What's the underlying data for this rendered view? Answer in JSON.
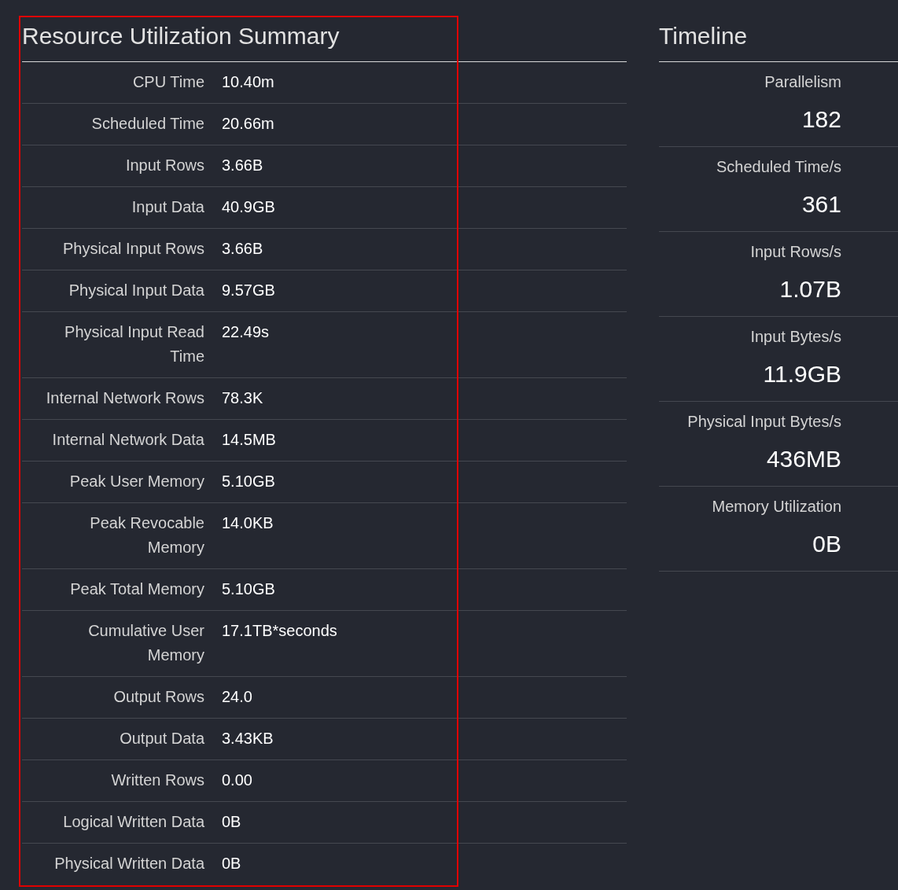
{
  "summary": {
    "title": "Resource Utilization Summary",
    "rows": [
      {
        "label": "CPU Time",
        "value": "10.40m"
      },
      {
        "label": "Scheduled Time",
        "value": "20.66m"
      },
      {
        "label": "Input Rows",
        "value": "3.66B"
      },
      {
        "label": "Input Data",
        "value": "40.9GB"
      },
      {
        "label": "Physical Input Rows",
        "value": "3.66B"
      },
      {
        "label": "Physical Input Data",
        "value": "9.57GB"
      },
      {
        "label": "Physical Input Read Time",
        "value": "22.49s"
      },
      {
        "label": "Internal Network Rows",
        "value": "78.3K"
      },
      {
        "label": "Internal Network Data",
        "value": "14.5MB"
      },
      {
        "label": "Peak User Memory",
        "value": "5.10GB"
      },
      {
        "label": "Peak Revocable Memory",
        "value": "14.0KB"
      },
      {
        "label": "Peak Total Memory",
        "value": "5.10GB"
      },
      {
        "label": "Cumulative User Memory",
        "value": "17.1TB*seconds"
      },
      {
        "label": "Output Rows",
        "value": "24.0"
      },
      {
        "label": "Output Data",
        "value": "3.43KB"
      },
      {
        "label": "Written Rows",
        "value": "0.00"
      },
      {
        "label": "Logical Written Data",
        "value": "0B"
      },
      {
        "label": "Physical Written Data",
        "value": "0B"
      }
    ]
  },
  "timeline": {
    "title": "Timeline",
    "items": [
      {
        "label": "Parallelism",
        "value": "182"
      },
      {
        "label": "Scheduled Time/s",
        "value": "361"
      },
      {
        "label": "Input Rows/s",
        "value": "1.07B"
      },
      {
        "label": "Input Bytes/s",
        "value": "11.9GB"
      },
      {
        "label": "Physical Input Bytes/s",
        "value": "436MB"
      },
      {
        "label": "Memory Utilization",
        "value": "0B"
      }
    ]
  }
}
